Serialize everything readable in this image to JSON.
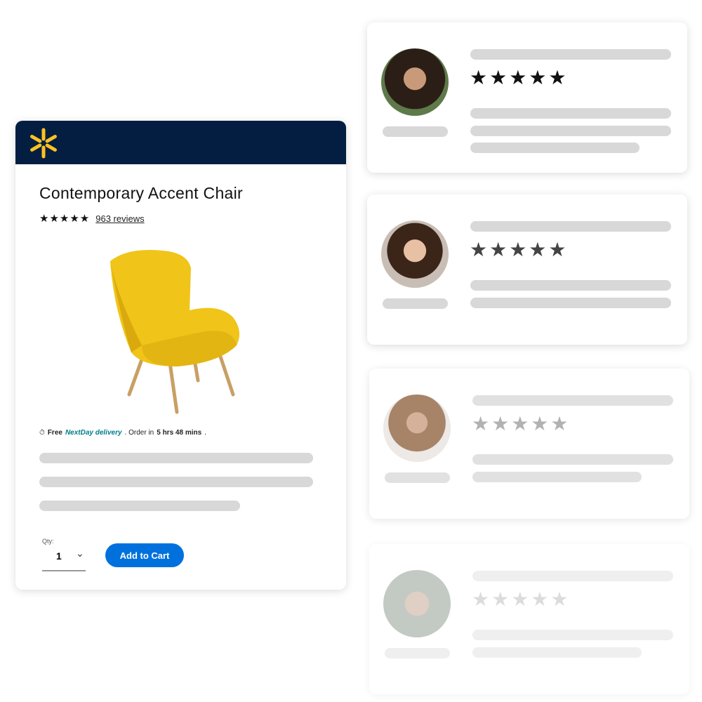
{
  "product": {
    "title": "Contemporary Accent Chair",
    "stars": "★★★★★",
    "reviews_link": "963 reviews",
    "delivery": {
      "free": "Free",
      "nextday": "NextDay delivery",
      "order_in": ". Order in",
      "time": "5 hrs 48 mins",
      "end": "."
    },
    "qty_label": "Qty:",
    "qty_value": "1",
    "add_to_cart": "Add to Cart",
    "colors": {
      "header": "#041e42",
      "logo": "#ffc220",
      "button": "#0071dc",
      "nextday": "#007d8a",
      "chair": "#f0c419"
    }
  },
  "reviews": [
    {
      "stars": "★★★★★",
      "rating": 5,
      "star_color": "#111111"
    },
    {
      "stars": "★★★★★",
      "rating": 5,
      "star_color": "#444444"
    },
    {
      "stars": "★★★★★",
      "rating": 5,
      "star_color": "#aaaaaa"
    },
    {
      "stars": "★★★★★",
      "rating": 5,
      "star_color": "#cccccc"
    }
  ]
}
